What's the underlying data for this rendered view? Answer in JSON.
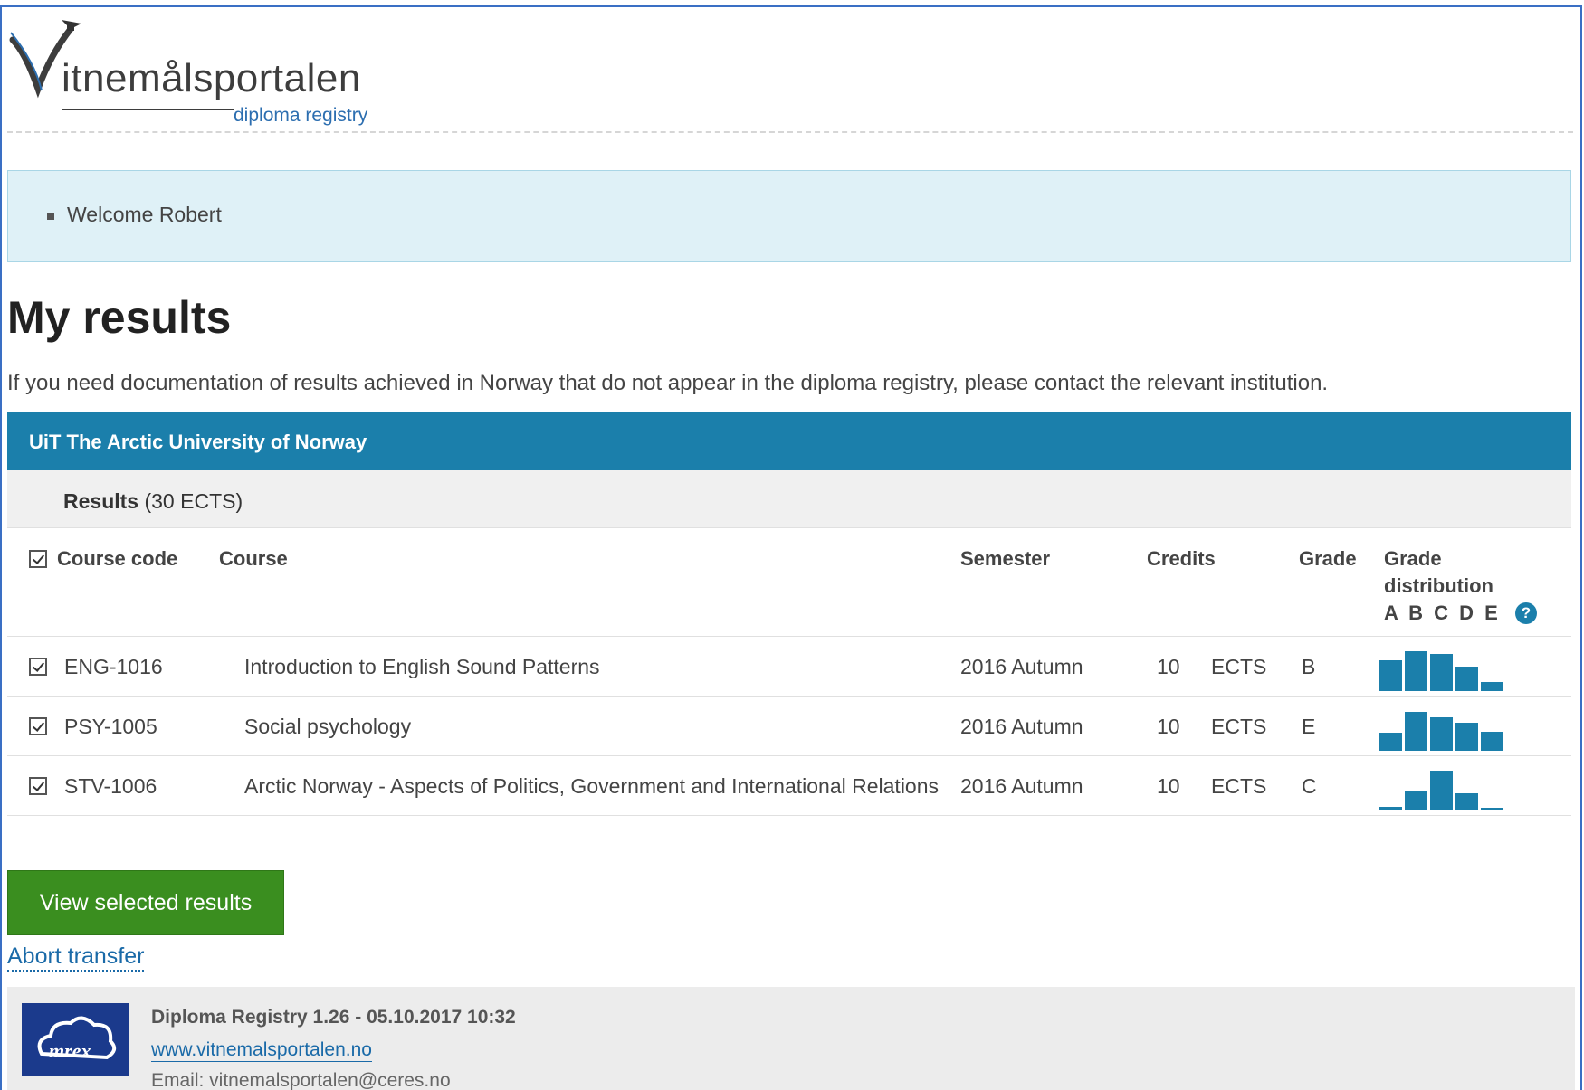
{
  "header": {
    "logo_word": "itnemålsportalen",
    "logo_sub": "diploma registry"
  },
  "welcome": {
    "text": "Welcome Robert"
  },
  "page": {
    "title": "My results",
    "intro": "If you need documentation of results achieved in Norway that do not appear in the diploma registry, please contact the relevant institution."
  },
  "institution": {
    "name": "UiT The Arctic University of Norway"
  },
  "results": {
    "label": "Results",
    "total": "(30 ECTS)"
  },
  "table": {
    "headers": {
      "code": "Course code",
      "course": "Course",
      "semester": "Semester",
      "credits": "Credits",
      "grade": "Grade",
      "dist_line1": "Grade",
      "dist_line2": "distribution",
      "dist_letters": "A B C D E"
    },
    "rows": [
      {
        "code": "ENG-1016",
        "course": "Introduction to English Sound Patterns",
        "semester": "2016 Autumn",
        "credits": "10",
        "unit": "ECTS",
        "grade": "B",
        "distribution": [
          0.65,
          0.85,
          0.78,
          0.52,
          0.2
        ]
      },
      {
        "code": "PSY-1005",
        "course": "Social psychology",
        "semester": "2016 Autumn",
        "credits": "10",
        "unit": "ECTS",
        "grade": "E",
        "distribution": [
          0.38,
          0.82,
          0.72,
          0.6,
          0.4
        ]
      },
      {
        "code": "STV-1006",
        "course": "Arctic Norway - Aspects of Politics, Government and International Relations",
        "semester": "2016 Autumn",
        "credits": "10",
        "unit": "ECTS",
        "grade": "C",
        "distribution": [
          0.08,
          0.4,
          0.85,
          0.36,
          0.04
        ]
      }
    ]
  },
  "actions": {
    "view_selected": "View selected results",
    "abort": "Abort transfer"
  },
  "footer": {
    "version": "Diploma Registry 1.26 - 05.10.2017 10:32",
    "website": "www.vitnemalsportalen.no",
    "email": "Email: vitnemalsportalen@ceres.no",
    "logo_text": "mrex"
  },
  "colors": {
    "accent": "#1b7fab",
    "button": "#3a8e1f",
    "welcome_bg": "#dff1f7"
  },
  "icons": {
    "checkbox": "checkbox-checked-icon",
    "help": "help-icon"
  }
}
